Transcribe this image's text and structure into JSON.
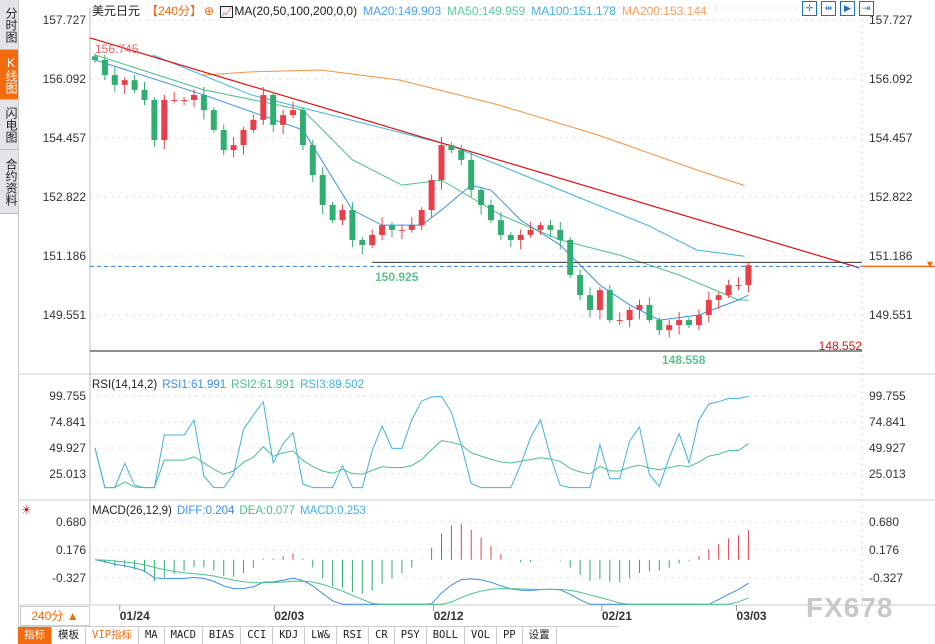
{
  "sidebar": {
    "tabs": [
      {
        "label": "分时图",
        "active": false
      },
      {
        "label": "K线图",
        "active": true
      },
      {
        "label": "闪电图",
        "active": false
      },
      {
        "label": "合约资料",
        "active": false
      }
    ]
  },
  "header": {
    "symbol": "美元日元",
    "timeframe": "【240分】",
    "ma_params": "MA(20,50,100,200,0,0)",
    "ma20": "MA20:149.903",
    "ma50": "MA50:149.959",
    "ma100": "MA100:151.178",
    "ma200": "MA200:153.144"
  },
  "rsi_header": {
    "params": "RSI(14,14,2)",
    "rsi1": "RSI1:61.991",
    "rsi2": "RSI2:61.991",
    "rsi3": "RSI3:89.502"
  },
  "macd_header": {
    "params": "MACD(26,12,9)",
    "diff": "DIFF:0.204",
    "dea": "DEA:0.077",
    "macd": "MACD:0.253"
  },
  "timeframe_button": "240分 ▲",
  "toolbar": [
    "指标",
    "模板",
    "VIP指标",
    "MA",
    "MACD",
    "BIAS",
    "CCI",
    "KDJ",
    "LW&",
    "RSI",
    "CR",
    "PSY",
    "BOLL",
    "VOL",
    "PP",
    "设置"
  ],
  "watermark": "FX678",
  "colors": {
    "up": "#e8404a",
    "down": "#2fae72",
    "ma20": "#3b8fe8",
    "ma50": "#49c18a",
    "ma100": "#3fb3e3",
    "ma200": "#f5913a",
    "trend": "#e01010",
    "accent": "#f26b0f"
  },
  "chart_data": {
    "type": "candlestick",
    "title": "美元日元 240分",
    "main": {
      "yticks": [
        "157.727",
        "156.092",
        "154.457",
        "152.822",
        "151.186",
        "149.551"
      ],
      "closes": [
        156.62,
        156.2,
        155.93,
        156.06,
        155.79,
        155.51,
        154.4,
        155.51,
        155.51,
        155.51,
        155.65,
        155.23,
        154.68,
        154.12,
        154.26,
        154.68,
        154.96,
        155.65,
        154.82,
        155.09,
        155.23,
        154.26,
        153.43,
        152.6,
        152.18,
        152.46,
        151.63,
        151.49,
        151.77,
        152.04,
        151.91,
        151.91,
        152.04,
        152.46,
        153.29,
        154.26,
        154.12,
        153.85,
        153.02,
        152.6,
        152.18,
        151.77,
        151.63,
        151.77,
        151.91,
        152.04,
        151.91,
        151.63,
        150.66,
        150.1,
        149.69,
        150.24,
        149.41,
        149.41,
        149.69,
        149.83,
        149.41,
        149.13,
        149.27,
        149.41,
        149.27,
        149.55,
        149.97,
        150.1,
        150.38,
        150.38,
        150.93
      ],
      "ma20": [
        [
          0,
          156.62
        ],
        [
          11,
          155.65
        ],
        [
          21,
          154.68
        ],
        [
          26,
          152.46
        ],
        [
          29,
          152.04
        ],
        [
          33,
          152.04
        ],
        [
          35,
          152.46
        ],
        [
          38,
          153.15
        ],
        [
          40,
          153.01
        ],
        [
          43,
          152.18
        ],
        [
          47,
          151.49
        ],
        [
          51,
          150.38
        ],
        [
          54,
          149.83
        ],
        [
          57,
          149.41
        ],
        [
          61,
          149.55
        ],
        [
          65,
          149.97
        ],
        [
          66,
          150.1
        ]
      ],
      "ma50": [
        [
          0,
          156.76
        ],
        [
          11,
          155.79
        ],
        [
          21,
          155.23
        ],
        [
          26,
          153.85
        ],
        [
          31,
          153.15
        ],
        [
          35,
          153.29
        ],
        [
          41,
          152.32
        ],
        [
          47,
          151.63
        ],
        [
          53,
          151.21
        ],
        [
          59,
          150.66
        ],
        [
          65,
          149.97
        ],
        [
          66,
          149.96
        ]
      ],
      "ma100": [
        [
          5.8,
          156.76
        ],
        [
          15.8,
          155.65
        ],
        [
          25.8,
          154.96
        ],
        [
          35.8,
          154.26
        ],
        [
          45.8,
          153.15
        ],
        [
          55.8,
          152.04
        ],
        [
          60.8,
          151.35
        ],
        [
          65.6,
          151.18
        ]
      ],
      "ma200": [
        [
          10.8,
          156.2
        ],
        [
          15.8,
          156.29
        ],
        [
          22.8,
          156.34
        ],
        [
          30.8,
          156.06
        ],
        [
          40.8,
          155.37
        ],
        [
          50.8,
          154.54
        ],
        [
          60.8,
          153.57
        ],
        [
          65.6,
          153.14
        ]
      ],
      "trendline": [
        [
          -0.5,
          157.23
        ],
        [
          77.2,
          150.86
        ]
      ],
      "annotations": {
        "high_label": "156.745",
        "support_label": "150.925",
        "low_label": "148.558",
        "low_line_label": "148.552",
        "support_level": 150.925,
        "low_level": 148.552
      }
    },
    "rsi": {
      "yticks": [
        "99.755",
        "74.841",
        "49.927",
        "25.013"
      ],
      "periods": [
        14,
        14,
        2
      ]
    },
    "macd": {
      "yticks": [
        "0.680",
        "0.176",
        "-0.327"
      ],
      "params": [
        26,
        12,
        9
      ]
    },
    "xticks": [
      {
        "label": "01/24",
        "index": 2.5
      },
      {
        "label": "02/03",
        "index": 18.1
      },
      {
        "label": "02/12",
        "index": 34.2
      },
      {
        "label": "02/21",
        "index": 51.2
      },
      {
        "label": "03/03",
        "index": 64.8
      }
    ]
  }
}
